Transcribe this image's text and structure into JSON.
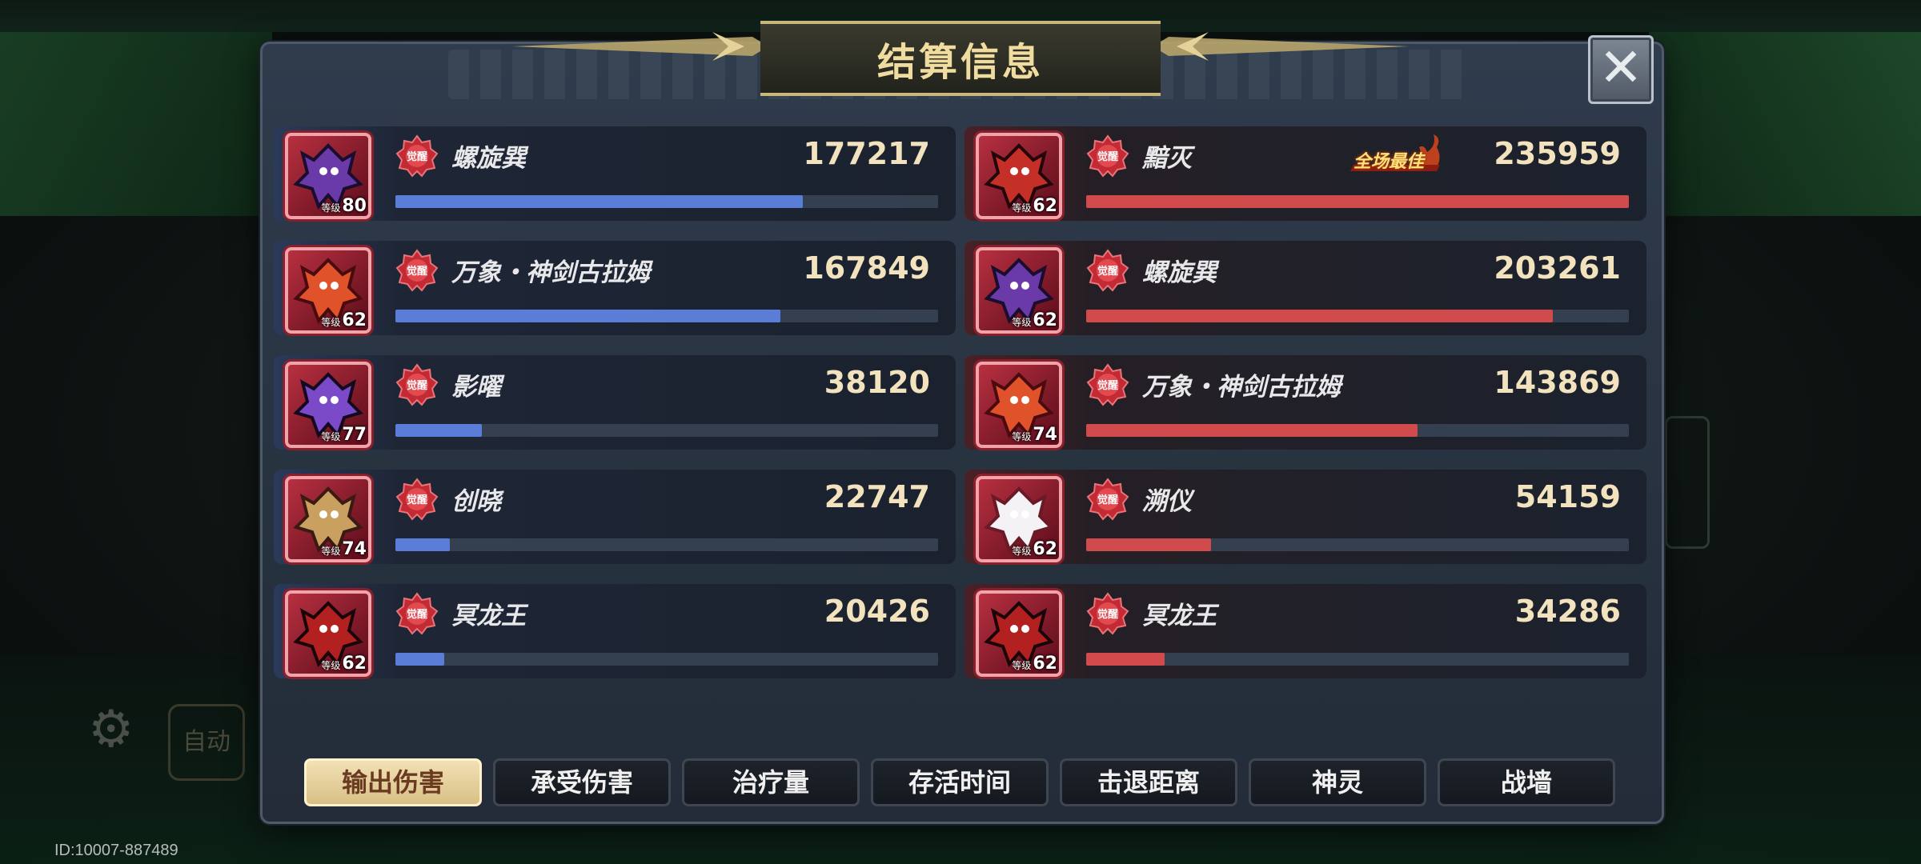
{
  "title": "结算信息",
  "user_id": "ID:10007-887489",
  "background": {
    "auto_label": "自动"
  },
  "badge_label": "觉醒",
  "mvp_label": "全场最佳",
  "level_prefix": "等级",
  "colors": {
    "blue_bar": "#5a7ed8",
    "red_bar": "#d14a4c",
    "value_text": "#f2e2bd",
    "tab_active_bg": "#e6d09a"
  },
  "left_team": [
    {
      "name": "螺旋巽",
      "value": "177217",
      "level": "80",
      "ratio": 0.75,
      "avatar": "purple-dragon"
    },
    {
      "name": "万象・神剑古拉姆",
      "value": "167849",
      "level": "62",
      "ratio": 0.71,
      "avatar": "red-dragon"
    },
    {
      "name": "影曜",
      "value": "38120",
      "level": "77",
      "ratio": 0.16,
      "avatar": "shadow-beast"
    },
    {
      "name": "创晓",
      "value": "22747",
      "level": "74",
      "ratio": 0.1,
      "avatar": "golden-knight"
    },
    {
      "name": "冥龙王",
      "value": "20426",
      "level": "62",
      "ratio": 0.09,
      "avatar": "dark-dragon-king"
    }
  ],
  "right_team": [
    {
      "name": "黯灭",
      "value": "235959",
      "level": "62",
      "ratio": 1.0,
      "mvp": true,
      "avatar": "crimson-dragon"
    },
    {
      "name": "螺旋巽",
      "value": "203261",
      "level": "62",
      "ratio": 0.86,
      "avatar": "purple-dragon"
    },
    {
      "name": "万象・神剑古拉姆",
      "value": "143869",
      "level": "74",
      "ratio": 0.61,
      "avatar": "red-dragon"
    },
    {
      "name": "溯仪",
      "value": "54159",
      "level": "62",
      "ratio": 0.23,
      "avatar": "white-spirit"
    },
    {
      "name": "冥龙王",
      "value": "34286",
      "level": "62",
      "ratio": 0.145,
      "avatar": "dark-dragon-king"
    }
  ],
  "tabs": [
    {
      "label": "输出伤害",
      "active": true
    },
    {
      "label": "承受伤害",
      "active": false
    },
    {
      "label": "治疗量",
      "active": false
    },
    {
      "label": "存活时间",
      "active": false
    },
    {
      "label": "击退距离",
      "active": false
    },
    {
      "label": "神灵",
      "active": false
    },
    {
      "label": "战墙",
      "active": false
    }
  ]
}
